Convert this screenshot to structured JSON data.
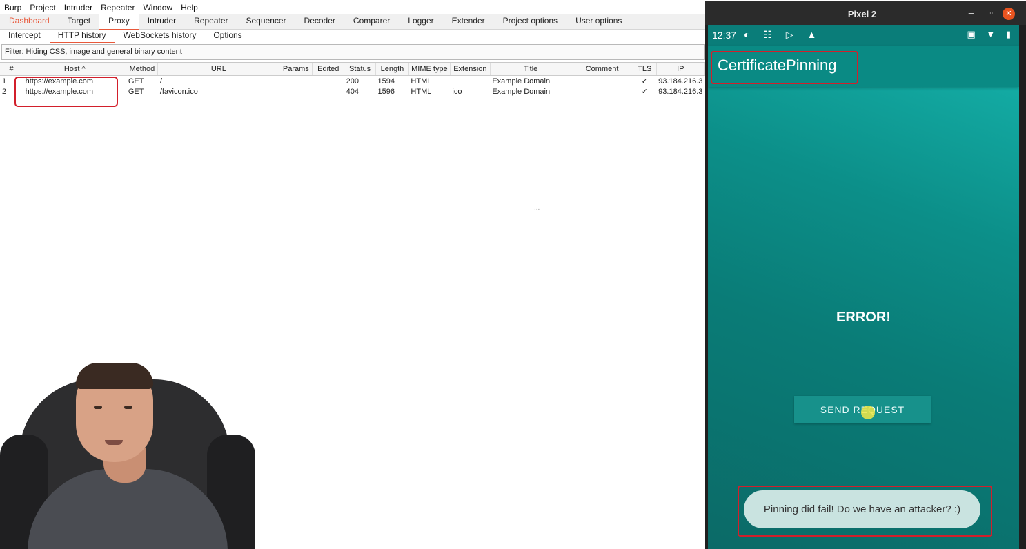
{
  "burp": {
    "menu": [
      "Burp",
      "Project",
      "Intruder",
      "Repeater",
      "Window",
      "Help"
    ],
    "main_tabs": [
      "Dashboard",
      "Target",
      "Proxy",
      "Intruder",
      "Repeater",
      "Sequencer",
      "Decoder",
      "Comparer",
      "Logger",
      "Extender",
      "Project options",
      "User options"
    ],
    "active_main_tab": "Proxy",
    "sub_tabs": [
      "Intercept",
      "HTTP history",
      "WebSockets history",
      "Options"
    ],
    "active_sub_tab": "HTTP history",
    "filter_text": "Filter: Hiding CSS, image and general binary content",
    "columns": [
      "#",
      "Host ^",
      "Method",
      "URL",
      "Params",
      "Edited",
      "Status",
      "Length",
      "MIME type",
      "Extension",
      "Title",
      "Comment",
      "TLS",
      "IP"
    ],
    "rows": [
      [
        "1",
        "https://example.com",
        "GET",
        "/",
        "",
        "",
        "200",
        "1594",
        "HTML",
        "",
        "Example Domain",
        "",
        "✓",
        "93.184.216.3"
      ],
      [
        "2",
        "https://example.com",
        "GET",
        "/favicon.ico",
        "",
        "",
        "404",
        "1596",
        "HTML",
        "ico",
        "Example Domain",
        "",
        "✓",
        "93.184.216.3"
      ]
    ],
    "splitter": "..."
  },
  "emulator": {
    "window_title": "Pixel 2",
    "status_time": "12:37",
    "status_icons_left": "◐ ☷ ▷ ▲",
    "status_icons_right": "▣ ▼ ▮",
    "app_title": "CertificatePinning",
    "error_text": "ERROR!",
    "send_button": "SEND REQUEST",
    "toast": "Pinning did fail! Do we have an attacker? :)"
  },
  "colors": {
    "burp_accent": "#e8583a",
    "highlight_box": "#d21f2b",
    "app_teal": "#0a8a84"
  }
}
